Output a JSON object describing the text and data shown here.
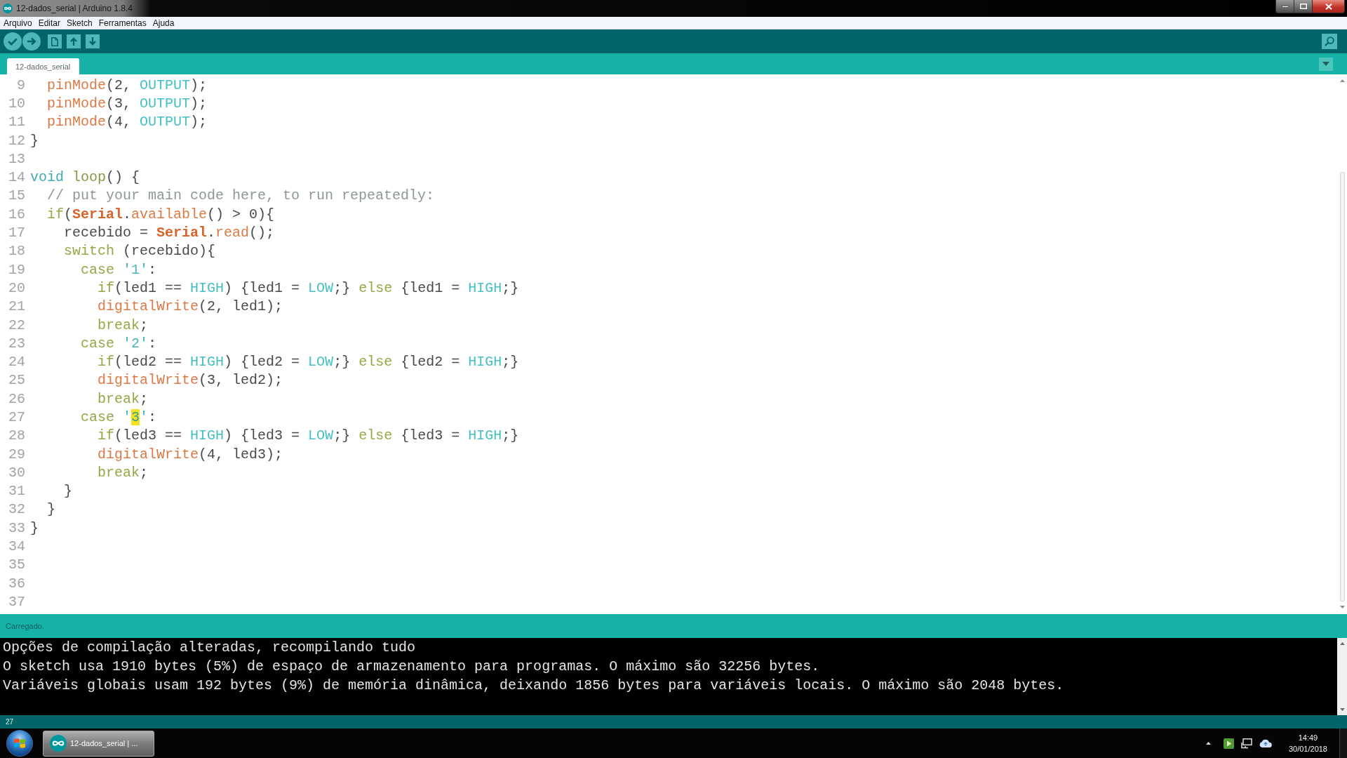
{
  "window": {
    "title": "12-dados_serial | Arduino 1.8.4"
  },
  "menu": [
    "Arquivo",
    "Editar",
    "Sketch",
    "Ferramentas",
    "Ajuda"
  ],
  "tabs": [
    {
      "label": "12-dados_serial",
      "selected": true
    }
  ],
  "editor": {
    "lines": [
      {
        "number": "9",
        "tokens": [
          {
            "text": "  pinMode",
            "kind": "function"
          },
          {
            "text": "(2, ",
            "kind": "plain"
          },
          {
            "text": "OUTPUT",
            "kind": "constant"
          },
          {
            "text": ");",
            "kind": "plain"
          }
        ]
      },
      {
        "number": "10",
        "tokens": [
          {
            "text": "  pinMode",
            "kind": "function"
          },
          {
            "text": "(3, ",
            "kind": "plain"
          },
          {
            "text": "OUTPUT",
            "kind": "constant"
          },
          {
            "text": ");",
            "kind": "plain"
          }
        ]
      },
      {
        "number": "11",
        "tokens": [
          {
            "text": "  pinMode",
            "kind": "function"
          },
          {
            "text": "(4, ",
            "kind": "plain"
          },
          {
            "text": "OUTPUT",
            "kind": "constant"
          },
          {
            "text": ");",
            "kind": "plain"
          }
        ]
      },
      {
        "number": "12",
        "tokens": [
          {
            "text": "}",
            "kind": "plain"
          }
        ]
      },
      {
        "number": "13"
      },
      {
        "number": "14",
        "tokens": [
          {
            "text": "void",
            "kind": "type"
          },
          {
            "text": " loop",
            "kind": "structure"
          },
          {
            "text": "() {",
            "kind": "plain"
          }
        ]
      },
      {
        "number": "15",
        "tokens": [
          {
            "text": "  // put your main code here, to run repeatedly:",
            "kind": "comment"
          }
        ]
      },
      {
        "number": "16",
        "tokens": [
          {
            "text": "  if",
            "kind": "keyword"
          },
          {
            "text": "(",
            "kind": "plain"
          },
          {
            "text": "Serial",
            "kind": "class"
          },
          {
            "text": ".",
            "kind": "plain"
          },
          {
            "text": "available",
            "kind": "function"
          },
          {
            "text": "() > 0){",
            "kind": "plain"
          }
        ]
      },
      {
        "number": "17",
        "tokens": [
          {
            "text": "    recebido = ",
            "kind": "plain"
          },
          {
            "text": "Serial",
            "kind": "class"
          },
          {
            "text": ".",
            "kind": "plain"
          },
          {
            "text": "read",
            "kind": "function"
          },
          {
            "text": "();",
            "kind": "plain"
          }
        ]
      },
      {
        "number": "18",
        "tokens": [
          {
            "text": "    switch",
            "kind": "keyword"
          },
          {
            "text": " (recebido){",
            "kind": "plain"
          }
        ]
      },
      {
        "number": "19",
        "tokens": [
          {
            "text": "      case",
            "kind": "keyword"
          },
          {
            "text": " '1'",
            "kind": "string"
          },
          {
            "text": ":",
            "kind": "plain"
          }
        ]
      },
      {
        "number": "20",
        "tokens": [
          {
            "text": "        if",
            "kind": "keyword"
          },
          {
            "text": "(led1 == ",
            "kind": "plain"
          },
          {
            "text": "HIGH",
            "kind": "constant"
          },
          {
            "text": ") {led1 = ",
            "kind": "plain"
          },
          {
            "text": "LOW",
            "kind": "constant"
          },
          {
            "text": ";} ",
            "kind": "plain"
          },
          {
            "text": "else",
            "kind": "keyword"
          },
          {
            "text": " {led1 = ",
            "kind": "plain"
          },
          {
            "text": "HIGH",
            "kind": "constant"
          },
          {
            "text": ";}",
            "kind": "plain"
          }
        ]
      },
      {
        "number": "21",
        "tokens": [
          {
            "text": "        digitalWrite",
            "kind": "function"
          },
          {
            "text": "(2, led1);",
            "kind": "plain"
          }
        ]
      },
      {
        "number": "22",
        "tokens": [
          {
            "text": "        break",
            "kind": "keyword"
          },
          {
            "text": ";",
            "kind": "plain"
          }
        ]
      },
      {
        "number": "23",
        "tokens": [
          {
            "text": "      case",
            "kind": "keyword"
          },
          {
            "text": " '2'",
            "kind": "string"
          },
          {
            "text": ":",
            "kind": "plain"
          }
        ]
      },
      {
        "number": "24",
        "tokens": [
          {
            "text": "        if",
            "kind": "keyword"
          },
          {
            "text": "(led2 == ",
            "kind": "plain"
          },
          {
            "text": "HIGH",
            "kind": "constant"
          },
          {
            "text": ") {led2 = ",
            "kind": "plain"
          },
          {
            "text": "LOW",
            "kind": "constant"
          },
          {
            "text": ";} ",
            "kind": "plain"
          },
          {
            "text": "else",
            "kind": "keyword"
          },
          {
            "text": " {led2 = ",
            "kind": "plain"
          },
          {
            "text": "HIGH",
            "kind": "constant"
          },
          {
            "text": ";}",
            "kind": "plain"
          }
        ]
      },
      {
        "number": "25",
        "tokens": [
          {
            "text": "        digitalWrite",
            "kind": "function"
          },
          {
            "text": "(3, led2);",
            "kind": "plain"
          }
        ]
      },
      {
        "number": "26",
        "tokens": [
          {
            "text": "        break",
            "kind": "keyword"
          },
          {
            "text": ";",
            "kind": "plain"
          }
        ]
      },
      {
        "number": "27",
        "tokens": [
          {
            "text": "      case",
            "kind": "keyword"
          },
          {
            "text": " '",
            "kind": "string"
          },
          {
            "text": "3",
            "kind": "match"
          },
          {
            "text": "'",
            "kind": "string"
          },
          {
            "text": ":",
            "kind": "plain"
          }
        ]
      },
      {
        "number": "28",
        "tokens": [
          {
            "text": "        if",
            "kind": "keyword"
          },
          {
            "text": "(led3 == ",
            "kind": "plain"
          },
          {
            "text": "HIGH",
            "kind": "constant"
          },
          {
            "text": ") {led3 = ",
            "kind": "plain"
          },
          {
            "text": "LOW",
            "kind": "constant"
          },
          {
            "text": ";} ",
            "kind": "plain"
          },
          {
            "text": "else",
            "kind": "keyword"
          },
          {
            "text": " {led3 = ",
            "kind": "plain"
          },
          {
            "text": "HIGH",
            "kind": "constant"
          },
          {
            "text": ";}",
            "kind": "plain"
          }
        ]
      },
      {
        "number": "29",
        "tokens": [
          {
            "text": "        digitalWrite",
            "kind": "function"
          },
          {
            "text": "(4, led3);",
            "kind": "plain"
          }
        ]
      },
      {
        "number": "30",
        "tokens": [
          {
            "text": "        break",
            "kind": "keyword"
          },
          {
            "text": ";",
            "kind": "plain"
          }
        ]
      },
      {
        "number": "31",
        "tokens": [
          {
            "text": "    }",
            "kind": "plain"
          }
        ]
      },
      {
        "number": "32",
        "tokens": [
          {
            "text": "  }",
            "kind": "plain"
          }
        ]
      },
      {
        "number": "33",
        "tokens": [
          {
            "text": "}",
            "kind": "plain"
          }
        ]
      },
      {
        "number": "34"
      },
      {
        "number": "35"
      },
      {
        "number": "36"
      },
      {
        "number": "37"
      }
    ]
  },
  "status": "Carregado.",
  "console": [
    "Opções de compilação alteradas, recompilando tudo",
    "O sketch usa 1910 bytes (5%) de espaço de armazenamento para programas. O máximo são 32256 bytes.",
    "Variáveis globais usam 192 bytes (9%) de memória dinâmica, deixando 1856 bytes para variáveis locais. O máximo são 2048 bytes."
  ],
  "line_indicator": "27",
  "taskbar": {
    "items": [
      {
        "label": "12-dados_serial | ...",
        "selected": true
      }
    ],
    "clock": {
      "time": "14:49",
      "date": "30/01/2018"
    }
  }
}
